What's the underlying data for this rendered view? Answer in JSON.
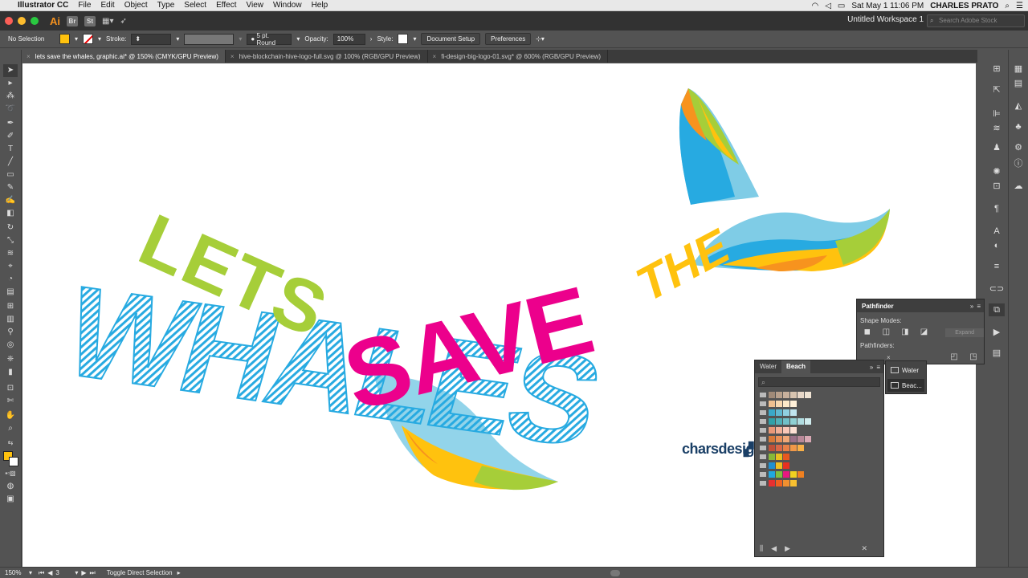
{
  "menubar": {
    "app": "Illustrator CC",
    "items": [
      "File",
      "Edit",
      "Object",
      "Type",
      "Select",
      "Effect",
      "View",
      "Window",
      "Help"
    ],
    "datetime": "Sat May 1  11:06 PM",
    "user": "CHARLES PRATO"
  },
  "appbar": {
    "logo": "Ai",
    "br": "Br",
    "st": "St",
    "workspace": "Untitled Workspace 1",
    "stock_placeholder": "Search Adobe Stock"
  },
  "control": {
    "selection": "No Selection",
    "fill_color": "#FFC20E",
    "stroke_label": "Stroke:",
    "brush": "5 pt. Round",
    "opacity_label": "Opacity:",
    "opacity": "100%",
    "style_label": "Style:",
    "document_setup": "Document Setup",
    "preferences": "Preferences"
  },
  "tabs": [
    {
      "label": "lets save the whales, graphic.ai* @ 150% (CMYK/GPU Preview)",
      "active": true
    },
    {
      "label": "hive-blockchain-hive-logo-full.svg @ 100% (RGB/GPU Preview)",
      "active": false
    },
    {
      "label": "fi-design-big-logo-01.svg* @ 600% (RGB/GPU Preview)",
      "active": false
    }
  ],
  "artwork": {
    "lets": "LETS",
    "save": "SAVE",
    "the": "THE",
    "whales": "WHALES",
    "logo": "charsdesign",
    "colors": {
      "green": "#A6CE39",
      "magenta": "#EC008C",
      "yellow": "#FFC20E",
      "blue": "#27AAE1",
      "orange": "#F7931E",
      "lightblue": "#7FCCE6"
    }
  },
  "pathfinder": {
    "title": "Pathfinder",
    "shape_modes": "Shape Modes:",
    "pathfinders": "Pathfinders:",
    "expand": "Expand"
  },
  "swatches": {
    "tabs": [
      "Water",
      "Beach"
    ],
    "rows": [
      [
        "#a08a78",
        "#b8a08c",
        "#c8b09c",
        "#d8c4b0",
        "#e8d8c8",
        "#f0e4d4"
      ],
      [
        "#f0c090",
        "#f8d8b0",
        "#fce8c8",
        "#fff0d8"
      ],
      [
        "#3aa8c8",
        "#60b8d0",
        "#90d0e0",
        "#c0e4ee"
      ],
      [
        "#30a0a8",
        "#50b0b8",
        "#70c0c8",
        "#90d0d4",
        "#b0dce0",
        "#d0ecee"
      ],
      [
        "#e89878",
        "#f0b098",
        "#f8c8b8",
        "#fde0d4"
      ],
      [
        "#d87838",
        "#e89058",
        "#f0a878",
        "#9a7088",
        "#b88898",
        "#d8a8b4"
      ],
      [
        "#c05038",
        "#d86848",
        "#e88048",
        "#f09848",
        "#f8b048"
      ],
      [
        "#88b838",
        "#e8c020",
        "#e85820"
      ],
      [
        "#2090d0",
        "#f0c020",
        "#e83020"
      ],
      [
        "#20a8e0",
        "#80c040",
        "#e81880",
        "#f0d020",
        "#f08020"
      ],
      [
        "#e83030",
        "#f06020",
        "#f09030",
        "#f8c030"
      ]
    ]
  },
  "flyout": {
    "items": [
      "Water",
      "Beac..."
    ]
  },
  "status": {
    "zoom": "150%",
    "artboard": "3",
    "tool": "Toggle Direct Selection"
  }
}
